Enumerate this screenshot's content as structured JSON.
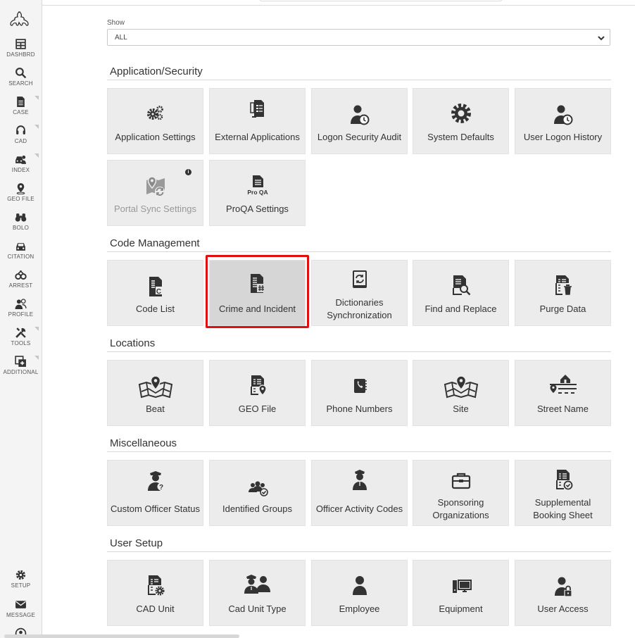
{
  "sidebar": {
    "items": [
      {
        "label": "DASHBRD",
        "icon": "dashboard-icon"
      },
      {
        "label": "SEARCH",
        "icon": "search-icon"
      },
      {
        "label": "CASE",
        "icon": "case-file-icon"
      },
      {
        "label": "CAD",
        "icon": "headset-icon"
      },
      {
        "label": "INDEX",
        "icon": "vehicle-person-icon"
      },
      {
        "label": "GEO FILE",
        "icon": "map-pin-icon"
      },
      {
        "label": "BOLO",
        "icon": "binoculars-icon"
      },
      {
        "label": "CITATION",
        "icon": "car-icon"
      },
      {
        "label": "ARREST",
        "icon": "handcuffs-icon"
      },
      {
        "label": "PROFILE",
        "icon": "profile-icon"
      },
      {
        "label": "TOOLS",
        "icon": "tools-icon"
      },
      {
        "label": "ADDITIONAL",
        "icon": "additional-icon"
      }
    ],
    "bottom": [
      {
        "label": "SETUP",
        "icon": "gear-icon"
      },
      {
        "label": "MESSAGE",
        "icon": "envelope-icon"
      }
    ]
  },
  "filter": {
    "label": "Show",
    "value": "ALL"
  },
  "sections": [
    {
      "title": "Application/Security",
      "tiles": [
        {
          "label": "Application Settings",
          "icon": "gears-icon"
        },
        {
          "label": "External Applications",
          "icon": "external-apps-icon"
        },
        {
          "label": "Logon Security Audit",
          "icon": "user-clock-icon"
        },
        {
          "label": "System Defaults",
          "icon": "cog-icon"
        },
        {
          "label": "User Logon History",
          "icon": "user-history-icon"
        },
        {
          "label": "Portal Sync Settings",
          "icon": "map-sync-icon"
        },
        {
          "label": "ProQA Settings",
          "icon": "proqa-icon",
          "icon_text": "Pro QA"
        }
      ]
    },
    {
      "title": "Code Management",
      "tiles": [
        {
          "label": "Code List",
          "icon": "code-list-icon"
        },
        {
          "label": "Crime and Incident",
          "icon": "crime-incident-icon"
        },
        {
          "label": "Dictionaries Synchronization",
          "icon": "dictionary-sync-icon"
        },
        {
          "label": "Find and Replace",
          "icon": "find-replace-icon"
        },
        {
          "label": "Purge Data",
          "icon": "purge-data-icon"
        }
      ]
    },
    {
      "title": "Locations",
      "tiles": [
        {
          "label": "Beat",
          "icon": "beat-map-icon"
        },
        {
          "label": "GEO File",
          "icon": "geo-file-icon"
        },
        {
          "label": "Phone Numbers",
          "icon": "phone-book-icon"
        },
        {
          "label": "Site",
          "icon": "site-map-icon"
        },
        {
          "label": "Street Name",
          "icon": "street-icon"
        }
      ]
    },
    {
      "title": "Miscellaneous",
      "tiles": [
        {
          "label": "Custom Officer Status",
          "icon": "officer-question-icon"
        },
        {
          "label": "Identified Groups",
          "icon": "group-check-icon"
        },
        {
          "label": "Officer Activity Codes",
          "icon": "officer-icon"
        },
        {
          "label": "Sponsoring Organizations",
          "icon": "briefcase-icon"
        },
        {
          "label": "Supplemental Booking Sheet",
          "icon": "booking-sheet-icon"
        }
      ]
    },
    {
      "title": "User Setup",
      "tiles": [
        {
          "label": "CAD Unit",
          "icon": "cad-unit-icon"
        },
        {
          "label": "Cad Unit Type",
          "icon": "unit-type-icon"
        },
        {
          "label": "Employee",
          "icon": "employee-icon"
        },
        {
          "label": "Equipment",
          "icon": "equipment-icon"
        },
        {
          "label": "User Access",
          "icon": "user-lock-icon"
        }
      ]
    }
  ],
  "colors": {
    "icon": "#333333",
    "tile_bg": "#ececec",
    "selected_border": "#e01010",
    "disabled_text": "#999999"
  }
}
